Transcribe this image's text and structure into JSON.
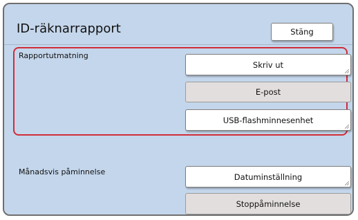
{
  "dialog": {
    "title": "ID-räknarrapport",
    "close_label": "Stäng"
  },
  "report_output": {
    "label": "Rapportutmatning",
    "buttons": [
      {
        "label": "Skriv ut",
        "enabled": true
      },
      {
        "label": "E-post",
        "enabled": false
      },
      {
        "label": "USB-flashminnesenhet",
        "enabled": true
      }
    ]
  },
  "monthly_reminder": {
    "label": "Månadsvis påminnelse",
    "buttons": [
      {
        "label": "Datuminställning",
        "enabled": true
      },
      {
        "label": "Stoppåminnelse",
        "enabled": false
      }
    ]
  },
  "colors": {
    "panel_background": "#c4d6eb",
    "highlight_border": "#d02c38",
    "disabled_button": "#e3dede"
  }
}
